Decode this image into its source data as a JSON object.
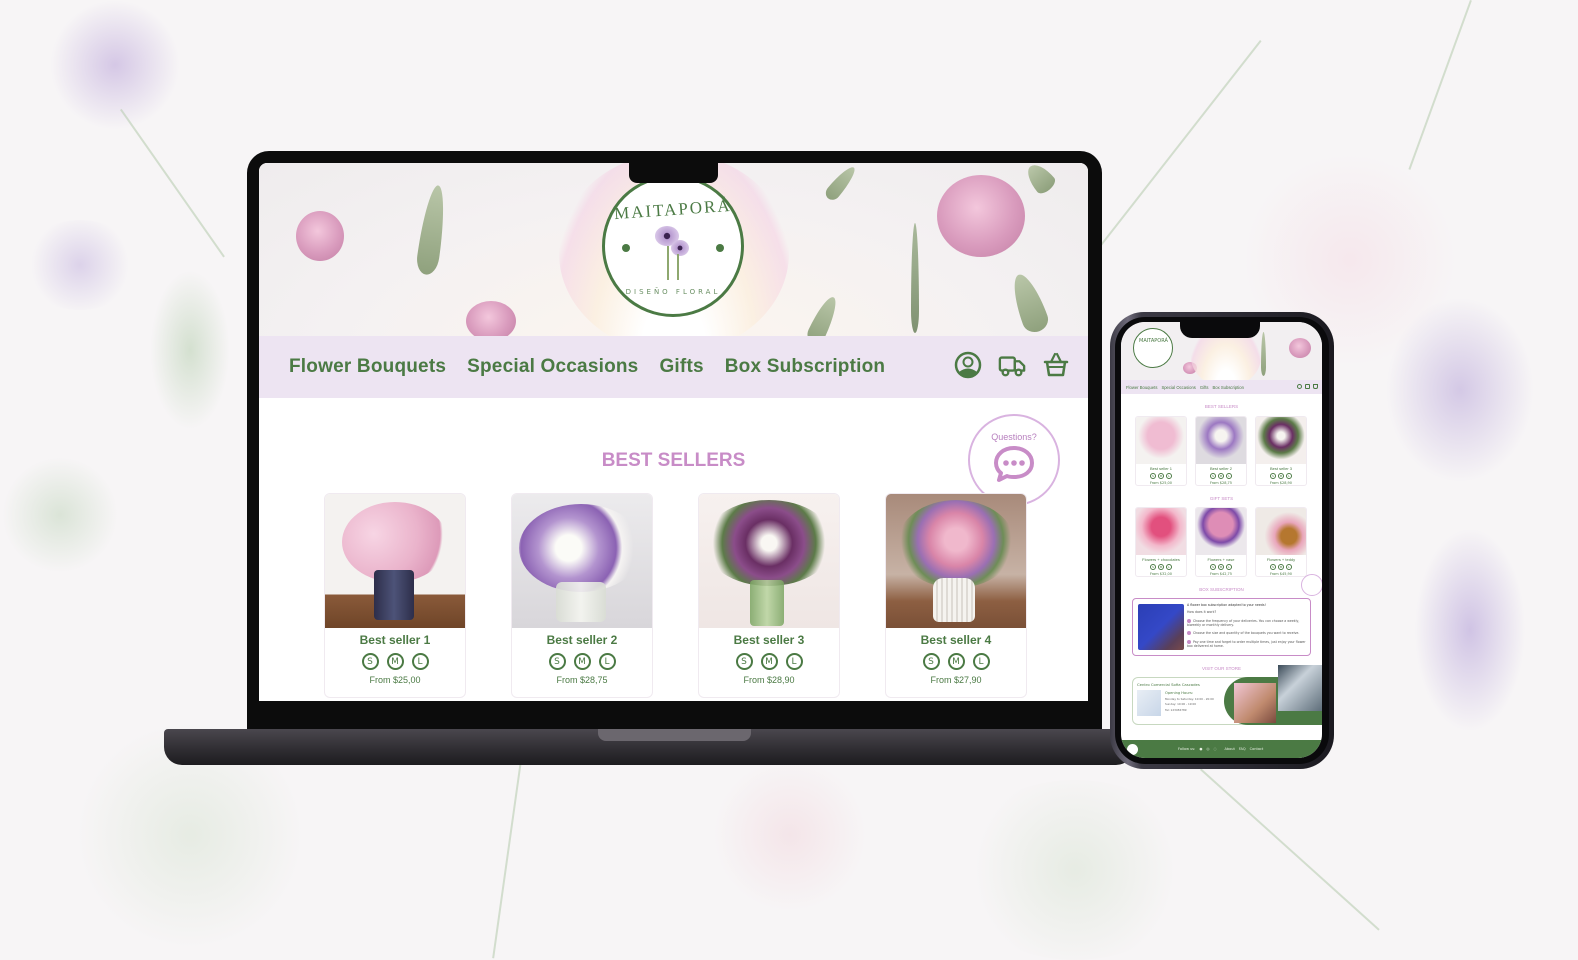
{
  "colors": {
    "brand_green": "#4b7a44",
    "accent_purple": "#c88cc7",
    "nav_bg": "#ede4f2",
    "bubble_border": "#d9b3e0"
  },
  "desktop": {
    "logo": {
      "title": "MAITAPORÁ",
      "subtitle": "DISEÑO FLORAL"
    },
    "nav": {
      "items": [
        "Flower Bouquets",
        "Special Occasions",
        "Gifts",
        "Box Subscription"
      ],
      "icons": [
        "user-account-icon",
        "delivery-truck-icon",
        "basket-icon"
      ]
    },
    "questions_label": "Questions?",
    "best_sellers": {
      "title": "BEST SELLERS",
      "products": [
        {
          "name": "Best seller 1",
          "sizes": [
            "S",
            "M",
            "L"
          ],
          "price": "From $25,00"
        },
        {
          "name": "Best seller 2",
          "sizes": [
            "S",
            "M",
            "L"
          ],
          "price": "From $28,75"
        },
        {
          "name": "Best seller 3",
          "sizes": [
            "S",
            "M",
            "L"
          ],
          "price": "From $28,90"
        },
        {
          "name": "Best seller 4",
          "sizes": [
            "S",
            "M",
            "L"
          ],
          "price": "From $27,90"
        }
      ]
    }
  },
  "mobile": {
    "logo_title": "MAITAPORÁ",
    "nav": [
      "Flower Bouquets",
      "Special Occasions",
      "Gifts",
      "Box Subscription"
    ],
    "best_sellers": {
      "title": "BEST SELLERS",
      "products": [
        {
          "name": "Best seller 1",
          "sizes": [
            "S",
            "M",
            "L"
          ],
          "price": "From $25,00"
        },
        {
          "name": "Best seller 2",
          "sizes": [
            "S",
            "M",
            "L"
          ],
          "price": "From $28,75"
        },
        {
          "name": "Best seller 3",
          "sizes": [
            "S",
            "M",
            "L"
          ],
          "price": "From $28,90"
        }
      ]
    },
    "gift_sets": {
      "title": "GIFT SETS",
      "products": [
        {
          "name": "Flowers + chocolates",
          "sizes": [
            "S",
            "M",
            "L"
          ],
          "price": "From $32,00"
        },
        {
          "name": "Flowers + vase",
          "sizes": [
            "S",
            "M",
            "L"
          ],
          "price": "From $42,75"
        },
        {
          "name": "Flowers + teddy",
          "sizes": [
            "S",
            "M",
            "L"
          ],
          "price": "From $45,90"
        }
      ]
    },
    "box_subscription": {
      "title": "BOX SUBSCRIPTION",
      "headline": "A flower box subscription adapted to your needs!",
      "how": "How does it work?",
      "steps": [
        "Choose the frequency of your deliveries. You can choose a weekly, biweekly or monthly delivery.",
        "Choose the size and quantity of the bouquets you want to receive.",
        "Pay one time and forget to order multiple times, just enjoy your flower box delivered at home."
      ]
    },
    "store": {
      "title": "VISIT OUR STORE",
      "name": "Centro Comercial Sofia Cascades",
      "hours_label": "Opening Hours:",
      "hours_weekday": "Monday to Saturday: 10:00 - 20:00",
      "hours_sunday": "Sunday: 10:00 - 19:00",
      "phone": "Tel: 123456789"
    },
    "footer": {
      "follow": "Follow us:",
      "links": [
        "About",
        "FAQ",
        "Contact"
      ],
      "social_icons": [
        "facebook-icon",
        "instagram-icon",
        "whatsapp-icon"
      ]
    }
  }
}
